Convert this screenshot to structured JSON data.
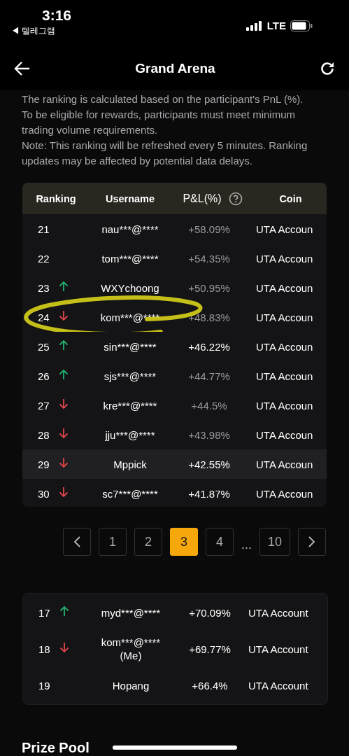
{
  "status_bar": {
    "time": "3:16",
    "back_app": "◀ 텔레그램",
    "network": "LTE"
  },
  "header": {
    "title": "Grand Arena"
  },
  "description": [
    "The ranking is calculated based on the participant's PnL (%).",
    "To be eligible for rewards, participants must meet minimum trading volume requirements.",
    "Note: This ranking will be refreshed every 5 minutes. Ranking updates may be affected by potential data delays."
  ],
  "table": {
    "columns": [
      "Ranking",
      "Username",
      "P&L(%)",
      "Coin"
    ],
    "rows": [
      {
        "rank": "21",
        "kind": "none",
        "username": "nau***@****",
        "pnl": "+58.09%",
        "muted": true,
        "coin": "UTA Accoun",
        "highlighted": false,
        "circled": false
      },
      {
        "rank": "22",
        "kind": "none",
        "username": "tom***@****",
        "pnl": "+54.35%",
        "muted": true,
        "coin": "UTA Accoun",
        "highlighted": false,
        "circled": false
      },
      {
        "rank": "23",
        "kind": "up",
        "username": "WXYchoong",
        "pnl": "+50.95%",
        "muted": true,
        "coin": "UTA Accoun",
        "highlighted": false,
        "circled": false
      },
      {
        "rank": "24",
        "kind": "down",
        "username": "kom***@****",
        "pnl": "+48.83%",
        "muted": true,
        "coin": "UTA Accoun",
        "highlighted": false,
        "circled": true
      },
      {
        "rank": "25",
        "kind": "up",
        "username": "sin***@****",
        "pnl": "+46.22%",
        "muted": false,
        "coin": "UTA Accoun",
        "highlighted": false,
        "circled": false
      },
      {
        "rank": "26",
        "kind": "up",
        "username": "sjs***@****",
        "pnl": "+44.77%",
        "muted": true,
        "coin": "UTA Accoun",
        "highlighted": false,
        "circled": false
      },
      {
        "rank": "27",
        "kind": "down",
        "username": "kre***@****",
        "pnl": "+44.5%",
        "muted": true,
        "coin": "UTA Accoun",
        "highlighted": false,
        "circled": false
      },
      {
        "rank": "28",
        "kind": "down",
        "username": "jju***@****",
        "pnl": "+43.98%",
        "muted": true,
        "coin": "UTA Accoun",
        "highlighted": false,
        "circled": false
      },
      {
        "rank": "29",
        "kind": "down",
        "username": "Mppick",
        "pnl": "+42.55%",
        "muted": false,
        "coin": "UTA Accoun",
        "highlighted": true,
        "circled": false
      },
      {
        "rank": "30",
        "kind": "down",
        "username": "sc7***@****",
        "pnl": "+41.87%",
        "muted": false,
        "coin": "UTA Accoun",
        "highlighted": false,
        "circled": false
      }
    ]
  },
  "pagination": [
    {
      "kind": "prev",
      "selected": false
    },
    {
      "kind": "page",
      "label": "1",
      "selected": false
    },
    {
      "kind": "page",
      "label": "2",
      "selected": false
    },
    {
      "kind": "page",
      "label": "3",
      "selected": true
    },
    {
      "kind": "page",
      "label": "4",
      "selected": false
    },
    {
      "kind": "ellipsis",
      "label": "..."
    },
    {
      "kind": "page",
      "label": "10",
      "selected": false
    },
    {
      "kind": "next",
      "selected": false
    }
  ],
  "my_ranking": [
    {
      "rank": "17",
      "kind": "up",
      "username": "myd***@****",
      "pnl": "+70.09%",
      "coin": "UTA Account"
    },
    {
      "rank": "18",
      "kind": "down",
      "username": "kom***@****",
      "me": "(Me)",
      "pnl": "+69.77%",
      "coin": "UTA Account"
    },
    {
      "rank": "19",
      "kind": "none",
      "username": "Hopang",
      "pnl": "+66.4%",
      "coin": "UTA Account"
    }
  ],
  "prize_pool": {
    "title": "Prize Pool"
  }
}
